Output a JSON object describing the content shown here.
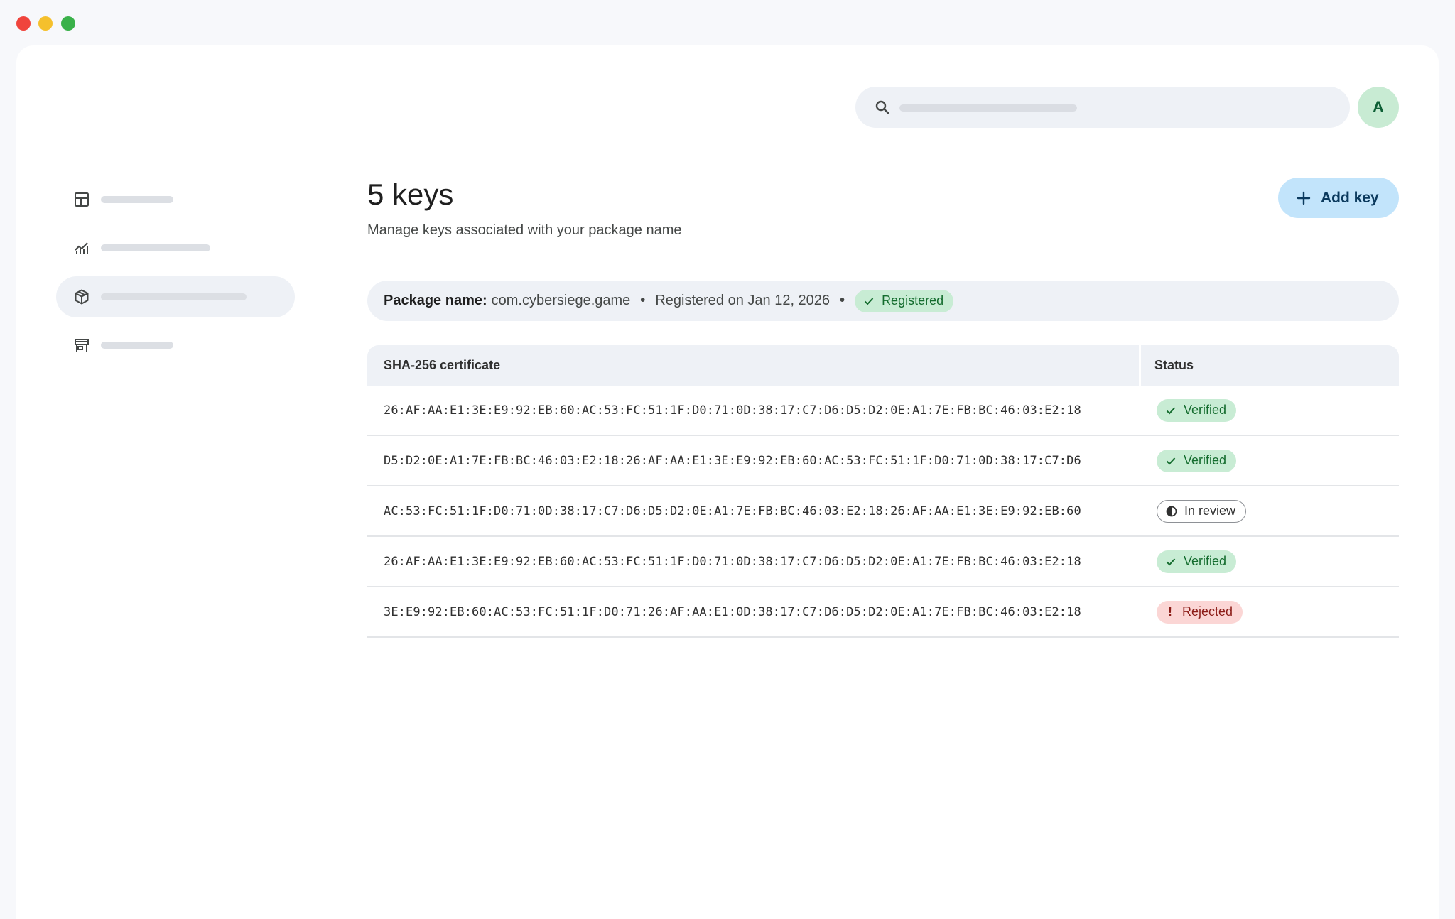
{
  "window": {
    "controls": [
      "close",
      "minimize",
      "maximize"
    ]
  },
  "header": {
    "search": {
      "icon": "search-icon",
      "placeholder": ""
    },
    "avatar": {
      "initial": "A",
      "color": "#c8ebd3"
    }
  },
  "sidebar": {
    "items": [
      {
        "icon": "dashboard-icon",
        "active": false
      },
      {
        "icon": "analytics-icon",
        "active": false
      },
      {
        "icon": "package-icon",
        "active": true
      },
      {
        "icon": "store-icon",
        "active": false
      }
    ]
  },
  "main": {
    "title": "5 keys",
    "subtitle": "Manage keys associated with your package name",
    "add_button": {
      "icon": "plus-icon",
      "label": "Add key"
    },
    "package": {
      "label": "Package name:",
      "name": "com.cybersiege.game",
      "separator": "•",
      "registered_text": "Registered on Jan 12, 2026",
      "status": "Registered"
    },
    "table": {
      "columns": [
        "SHA-256 certificate",
        "Status"
      ],
      "rows": [
        {
          "cert": "26:AF:AA:E1:3E:E9:92:EB:60:AC:53:FC:51:1F:D0:71:0D:38:17:C7:D6:D5:D2:0E:A1:7E:FB:BC:46:03:E2:18",
          "status": "Verified",
          "kind": "ok"
        },
        {
          "cert": "D5:D2:0E:A1:7E:FB:BC:46:03:E2:18:26:AF:AA:E1:3E:E9:92:EB:60:AC:53:FC:51:1F:D0:71:0D:38:17:C7:D6",
          "status": "Verified",
          "kind": "ok"
        },
        {
          "cert": "AC:53:FC:51:1F:D0:71:0D:38:17:C7:D6:D5:D2:0E:A1:7E:FB:BC:46:03:E2:18:26:AF:AA:E1:3E:E9:92:EB:60",
          "status": "In review",
          "kind": "review"
        },
        {
          "cert": "26:AF:AA:E1:3E:E9:92:EB:60:AC:53:FC:51:1F:D0:71:0D:38:17:C7:D6:D5:D2:0E:A1:7E:FB:BC:46:03:E2:18",
          "status": "Verified",
          "kind": "ok"
        },
        {
          "cert": "3E:E9:92:EB:60:AC:53:FC:51:1F:D0:71:26:AF:AA:E1:0D:38:17:C7:D6:D5:D2:0E:A1:7E:FB:BC:46:03:E2:18",
          "status": "Rejected",
          "kind": "bad"
        }
      ]
    }
  },
  "colors": {
    "accent_button": "#c2e4fb",
    "verified": "#c8ecd4",
    "rejected": "#fbd6d5",
    "surface": "#eef1f6"
  }
}
